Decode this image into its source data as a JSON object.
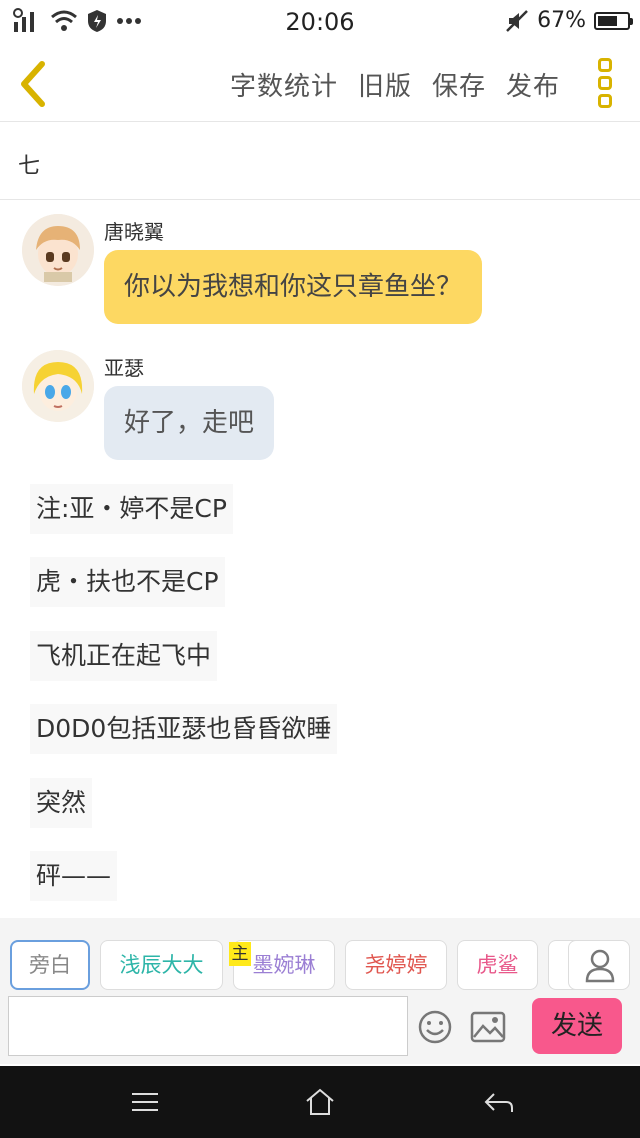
{
  "status_bar": {
    "time": "20:06",
    "battery": "67%",
    "battery_level": 0.67
  },
  "toolbar": {
    "back_icon": "chevron-left-icon",
    "word_count_label": "字数统计",
    "old_version_label": "旧版",
    "save_label": "保存",
    "publish_label": "发布",
    "more_icon": "more-vertical-icon"
  },
  "chapter": {
    "title": "七"
  },
  "messages": [
    {
      "speaker": "唐晓翼",
      "text": "你以为我想和你这只章鱼坐？"
    },
    {
      "speaker": "亚瑟",
      "text": "好了，走吧"
    }
  ],
  "narration": [
    "注:亚・婷不是CP",
    "虎・扶也不是CP",
    "飞机正在起飞中",
    "D0D0包括亚瑟也昏昏欲睡",
    "突然",
    "砰——"
  ],
  "characters": [
    {
      "label": "旁白",
      "color": "#888888"
    },
    {
      "label": "浅辰大大",
      "color": "#2db5a8"
    },
    {
      "label": "墨婉琳",
      "color": "#9b7fd4",
      "badge": "主"
    },
    {
      "label": "尧婷婷",
      "color": "#e0564f"
    },
    {
      "label": "虎鲨",
      "color": "#e8588a"
    }
  ],
  "composer": {
    "input_value": "",
    "send_label": "发送",
    "emoji_icon": "smiley-icon",
    "image_icon": "image-icon",
    "character_icon": "person-icon"
  },
  "colors": {
    "accent_yellow": "#fdd862",
    "send_pink": "#f8588c",
    "bubble_blue": "#e3eaf2"
  }
}
